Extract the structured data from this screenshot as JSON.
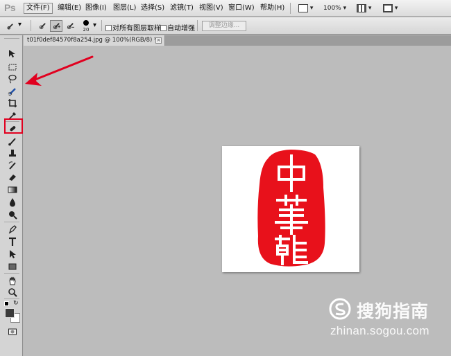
{
  "app": {
    "logo": "Ps"
  },
  "menu": {
    "items": [
      "文件(F)",
      "编辑(E)",
      "图像(I)",
      "图层(L)",
      "选择(S)",
      "滤镜(T)",
      "视图(V)",
      "窗口(W)",
      "帮助(H)"
    ],
    "active_index": 0
  },
  "view_controls": {
    "zoom": "100%"
  },
  "options_bar": {
    "brush_size": "20",
    "sample_all_layers_label": "对所有图层取样",
    "auto_enhance_label": "自动增强",
    "refine_edge_label": "调整边缘..."
  },
  "document": {
    "tab_title": "t01f0def84570f8a254.jpg @ 100%(RGB/8) *",
    "close_glyph": "×"
  },
  "toolbox": {
    "tools": [
      "move-tool",
      "marquee-tool",
      "lasso-tool",
      "quick-selection-tool",
      "crop-tool",
      "eyedropper-tool",
      "healing-brush-tool",
      "brush-tool",
      "clone-stamp-tool",
      "history-brush-tool",
      "eraser-tool",
      "gradient-tool",
      "blur-tool",
      "dodge-tool",
      "pen-tool",
      "type-tool",
      "path-selection-tool",
      "shape-tool",
      "hand-tool",
      "zoom-tool"
    ],
    "selected": "quick-selection-tool",
    "foreground_color": "#3a3a3a",
    "background_color": "#ffffff"
  },
  "image": {
    "seal_text": "中華龍",
    "seal_color": "#e8111b"
  },
  "annotation": {
    "color": "#e1001f"
  },
  "watermark": {
    "brand": "搜狗指南",
    "url": "zhinan.sogou.com"
  }
}
